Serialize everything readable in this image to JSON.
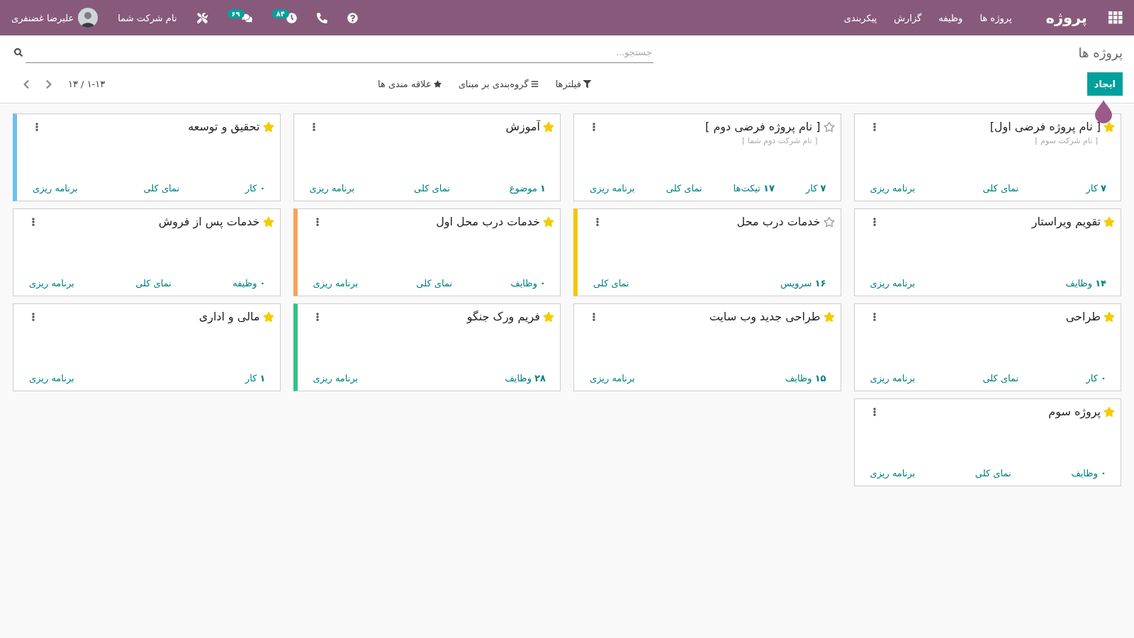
{
  "navbar": {
    "brand": "پروژه",
    "menu": [
      "پروژه ها",
      "وظیفه",
      "گزارش",
      "پیکربندی"
    ],
    "activity_count": "۸۴",
    "messages_count": "۶۹",
    "company": "نام شرکت شما",
    "user": "علیرضا غضنفری"
  },
  "control_panel": {
    "breadcrumb": "پروژه ها",
    "search": {
      "placeholder": "جستجو..."
    },
    "create_button": "ایجاد",
    "filters": [
      "فیلترها",
      "گروه‌بندی بر مبنای",
      "علاقه مندی ها"
    ],
    "pager": "۱-۱۳ / ۱۳"
  },
  "projects": [
    {
      "name": "[ نام پروژه فرضی اول]",
      "company": "[ نام شرکت سوم ]",
      "favorite": true,
      "stats": [
        "**۷** کار",
        "نمای کلی",
        "برنامه ریزی"
      ]
    },
    {
      "name": "[ نام پروژه فرضی دوم ]",
      "company": "[ نام شرکت دوم شما ]",
      "favorite": false,
      "stats": [
        "**۷** کار",
        "**۱۷** تیکت‌ها",
        "نمای کلی",
        "برنامه ریزی"
      ]
    },
    {
      "name": "آموزش",
      "favorite": true,
      "stats": [
        "**۱** موضوع",
        "نمای کلی",
        "برنامه ریزی"
      ]
    },
    {
      "name": "تحقیق و توسعه",
      "favorite": true,
      "color": "#6cc1ed",
      "stats": [
        "**۰** کار",
        "نمای کلی",
        "برنامه ریزی"
      ]
    },
    {
      "name": "تقویم ویراستار",
      "favorite": true,
      "stats": [
        "**۱۴** وظایف",
        "برنامه ریزی"
      ]
    },
    {
      "name": "خدمات درب محل",
      "favorite": false,
      "color": "#f4c609",
      "stats": [
        "**۱۶** سرویس",
        "نمای کلی"
      ]
    },
    {
      "name": "خدمات درب محل اول",
      "favorite": true,
      "color": "#f7a35c",
      "stats": [
        "**۰** وظایف",
        "نمای کلی",
        "برنامه ریزی"
      ]
    },
    {
      "name": "خدمات پس از فروش",
      "favorite": true,
      "stats": [
        "**۰** وظیفه",
        "نمای کلی",
        "برنامه ریزی"
      ]
    },
    {
      "name": "طراحی",
      "favorite": true,
      "stats": [
        "**۰** کار",
        "نمای کلی",
        "برنامه ریزی"
      ]
    },
    {
      "name": "طراحی جدید وب سایت",
      "favorite": true,
      "stats": [
        "**۱۵** وظایف",
        "برنامه ریزی"
      ]
    },
    {
      "name": "فریم ورک جنگو",
      "favorite": true,
      "color": "#30c381",
      "stats": [
        "**۲۸** وظایف",
        "برنامه ریزی"
      ]
    },
    {
      "name": "مالی و اداری",
      "favorite": true,
      "stats": [
        "**۱** کار",
        "برنامه ریزی"
      ]
    },
    {
      "name": "پروژه سوم",
      "favorite": true,
      "stats": [
        "**۰** وظایف",
        "نمای کلی",
        "برنامه ریزی"
      ]
    }
  ]
}
